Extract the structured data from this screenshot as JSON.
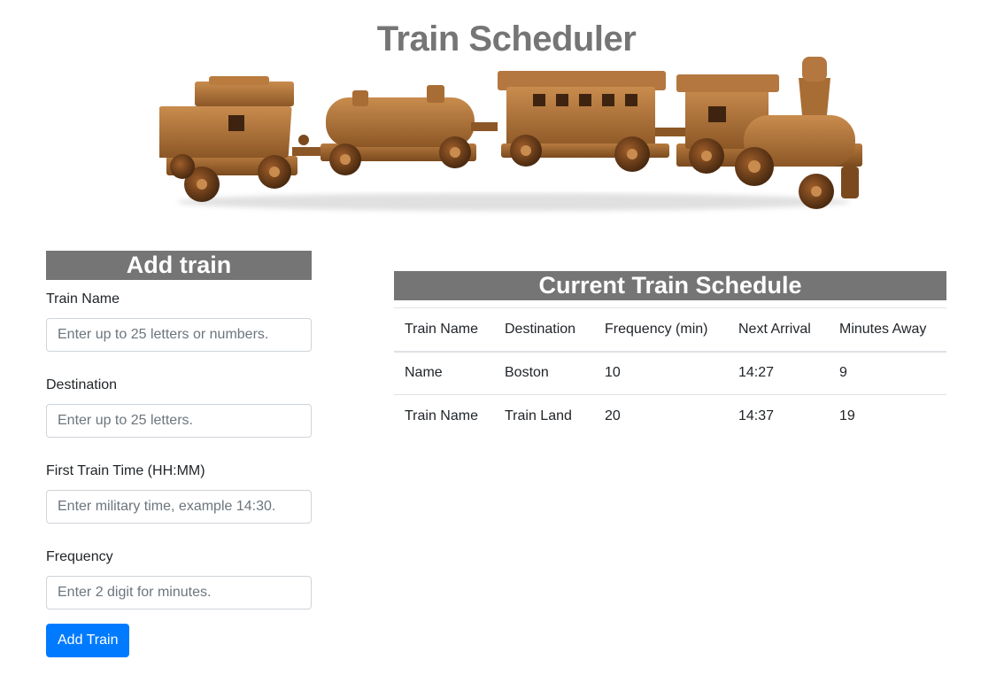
{
  "page": {
    "title": "Train Scheduler"
  },
  "hero_image": {
    "alt": "wooden toy train"
  },
  "form": {
    "header": "Add train",
    "fields": [
      {
        "label": "Train Name",
        "placeholder": "Enter up to 25 letters or numbers.",
        "value": ""
      },
      {
        "label": "Destination",
        "placeholder": "Enter up to 25 letters.",
        "value": ""
      },
      {
        "label": "First Train Time (HH:MM)",
        "placeholder": "Enter military time, example 14:30.",
        "value": ""
      },
      {
        "label": "Frequency",
        "placeholder": "Enter 2 digit for minutes.",
        "value": ""
      }
    ],
    "submit_label": "Add Train"
  },
  "schedule": {
    "header": "Current Train Schedule",
    "columns": [
      "Train Name",
      "Destination",
      "Frequency (min)",
      "Next Arrival",
      "Minutes Away"
    ],
    "rows": [
      [
        "Name",
        "Boston",
        "10",
        "14:27",
        "9"
      ],
      [
        "Train Name",
        "Train Land",
        "20",
        "14:37",
        "19"
      ]
    ]
  },
  "colors": {
    "header_bg": "#757575",
    "primary": "#007bff"
  }
}
